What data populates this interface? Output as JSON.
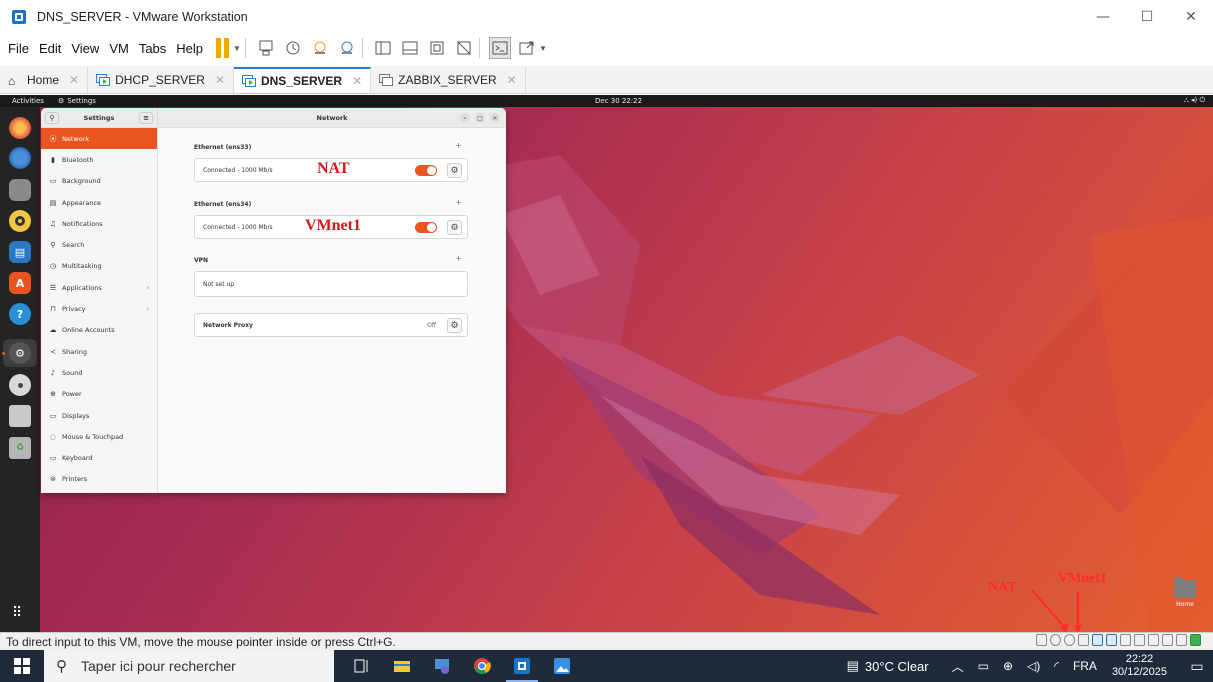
{
  "window": {
    "title": "DNS_SERVER - VMware Workstation"
  },
  "menubar": {
    "items": [
      "File",
      "Edit",
      "View",
      "VM",
      "Tabs",
      "Help"
    ]
  },
  "tabs": [
    {
      "label": "Home",
      "active": false
    },
    {
      "label": "DHCP_SERVER",
      "active": false
    },
    {
      "label": "DNS_SERVER",
      "active": true
    },
    {
      "label": "ZABBIX_SERVER",
      "active": false
    }
  ],
  "gnome": {
    "activities": "Activities",
    "app_name": "Settings",
    "clock": "Dec 30  22:22"
  },
  "settings": {
    "sidebar_title": "Settings",
    "panel_title": "Network",
    "sidebar_items": [
      {
        "label": "Network",
        "icon": "network-icon",
        "glyph": "⦿",
        "selected": true,
        "chevron": false
      },
      {
        "label": "Bluetooth",
        "icon": "bluetooth-icon",
        "glyph": "▮",
        "selected": false,
        "chevron": false
      },
      {
        "label": "Background",
        "icon": "background-icon",
        "glyph": "▭",
        "selected": false,
        "chevron": false
      },
      {
        "label": "Appearance",
        "icon": "appearance-icon",
        "glyph": "▤",
        "selected": false,
        "chevron": false
      },
      {
        "label": "Notifications",
        "icon": "bell-icon",
        "glyph": "♫",
        "selected": false,
        "chevron": false
      },
      {
        "label": "Search",
        "icon": "search-icon",
        "glyph": "⚲",
        "selected": false,
        "chevron": false
      },
      {
        "label": "Multitasking",
        "icon": "multitasking-icon",
        "glyph": "◷",
        "selected": false,
        "chevron": false
      },
      {
        "label": "Applications",
        "icon": "applications-icon",
        "glyph": "☰",
        "selected": false,
        "chevron": true
      },
      {
        "label": "Privacy",
        "icon": "lock-icon",
        "glyph": "⊓",
        "selected": false,
        "chevron": true
      },
      {
        "label": "Online Accounts",
        "icon": "cloud-icon",
        "glyph": "☁",
        "selected": false,
        "chevron": false
      },
      {
        "label": "Sharing",
        "icon": "share-icon",
        "glyph": "≺",
        "selected": false,
        "chevron": false
      },
      {
        "label": "Sound",
        "icon": "music-icon",
        "glyph": "♪",
        "selected": false,
        "chevron": false
      },
      {
        "label": "Power",
        "icon": "power-icon",
        "glyph": "⊕",
        "selected": false,
        "chevron": false
      },
      {
        "label": "Displays",
        "icon": "display-icon",
        "glyph": "▭",
        "selected": false,
        "chevron": false
      },
      {
        "label": "Mouse & Touchpad",
        "icon": "mouse-icon",
        "glyph": "◌",
        "selected": false,
        "chevron": false
      },
      {
        "label": "Keyboard",
        "icon": "keyboard-icon",
        "glyph": "▭",
        "selected": false,
        "chevron": false
      },
      {
        "label": "Printers",
        "icon": "printer-icon",
        "glyph": "⊜",
        "selected": false,
        "chevron": false
      }
    ],
    "ethernet1": {
      "title": "Ethernet (ens33)",
      "status": "Connected - 1000 Mb/s",
      "note": "NAT",
      "enabled": true
    },
    "ethernet2": {
      "title": "Ethernet (ens34)",
      "status": "Connected - 1000 Mb/s",
      "note": "VMnet1",
      "enabled": true
    },
    "vpn": {
      "title": "VPN",
      "status": "Not set up"
    },
    "proxy": {
      "label": "Network Proxy",
      "state": "Off"
    }
  },
  "desktop": {
    "home_label": "Home"
  },
  "annotations": {
    "nat": "NAT",
    "vmnet1": "VMnet1"
  },
  "statusbar": {
    "message": "To direct input to this VM, move the mouse pointer inside or press Ctrl+G."
  },
  "taskbar": {
    "search_placeholder": "Taper ici pour rechercher",
    "weather": "30°C  Clear",
    "language": "FRA",
    "time": "22:22",
    "date": "30/12/2025"
  },
  "colors": {
    "ubuntu_orange": "#e95420",
    "vmware_blue": "#2a7fd4",
    "annotation_red": "#d11a1a"
  }
}
